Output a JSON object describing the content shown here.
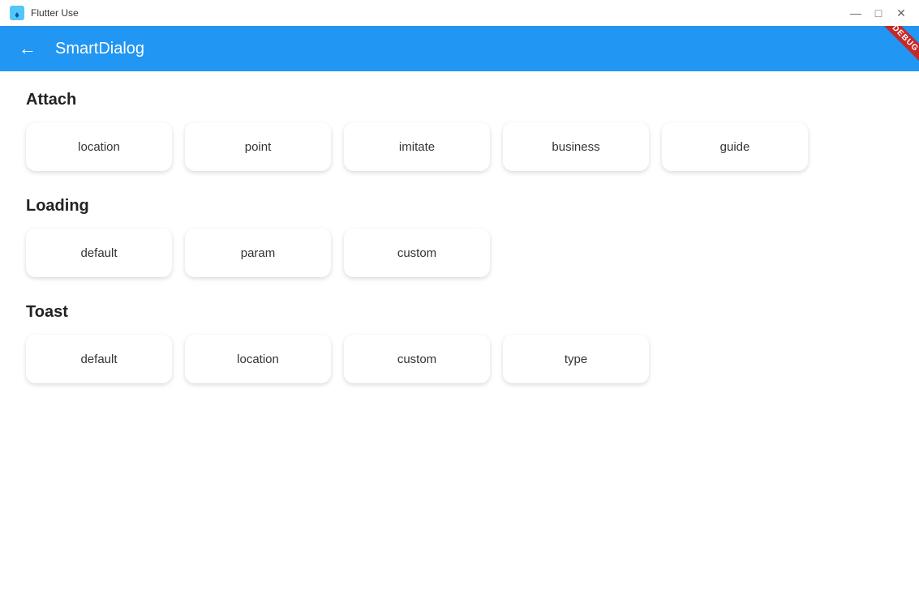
{
  "titleBar": {
    "appName": "Flutter Use",
    "minimizeLabel": "—",
    "maximizeLabel": "□",
    "closeLabel": "✕"
  },
  "appBar": {
    "title": "SmartDialog",
    "backIcon": "←",
    "debugBadge": "DEBUG"
  },
  "sections": [
    {
      "id": "attach",
      "title": "Attach",
      "buttons": [
        "location",
        "point",
        "imitate",
        "business",
        "guide"
      ]
    },
    {
      "id": "loading",
      "title": "Loading",
      "buttons": [
        "default",
        "param",
        "custom"
      ]
    },
    {
      "id": "toast",
      "title": "Toast",
      "buttons": [
        "default",
        "location",
        "custom",
        "type"
      ]
    }
  ]
}
